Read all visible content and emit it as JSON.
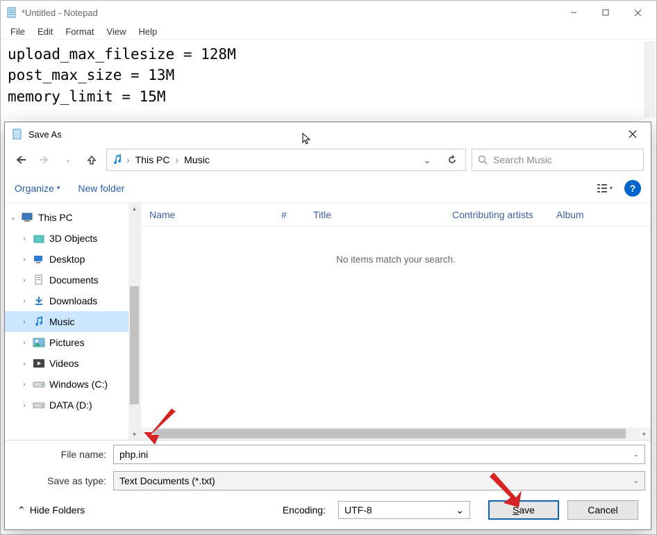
{
  "notepad": {
    "title": "*Untitled - Notepad",
    "menus": [
      "File",
      "Edit",
      "Format",
      "View",
      "Help"
    ],
    "content": "upload_max_filesize = 128M\npost_max_size = 13M\nmemory_limit = 15M"
  },
  "dialog": {
    "title": "Save As",
    "nav_back_enabled": true,
    "nav_forward_enabled": false,
    "breadcrumb": [
      "This PC",
      "Music"
    ],
    "search_placeholder": "Search Music",
    "organize_label": "Organize",
    "newfolder_label": "New folder",
    "tree": {
      "root": "This PC",
      "items": [
        {
          "label": "3D Objects",
          "icon": "folder-3d"
        },
        {
          "label": "Desktop",
          "icon": "desktop"
        },
        {
          "label": "Documents",
          "icon": "documents"
        },
        {
          "label": "Downloads",
          "icon": "downloads"
        },
        {
          "label": "Music",
          "icon": "music",
          "selected": true
        },
        {
          "label": "Pictures",
          "icon": "pictures"
        },
        {
          "label": "Videos",
          "icon": "videos"
        },
        {
          "label": "Windows (C:)",
          "icon": "drive"
        },
        {
          "label": "DATA (D:)",
          "icon": "drive"
        }
      ]
    },
    "columns": [
      "Name",
      "#",
      "Title",
      "Contributing artists",
      "Album"
    ],
    "empty_message": "No items match your search.",
    "filename_label": "File name:",
    "filename_value": "php.ini",
    "savetype_label": "Save as type:",
    "savetype_value": "Text Documents (*.txt)",
    "hide_folders_label": "Hide Folders",
    "encoding_label": "Encoding:",
    "encoding_value": "UTF-8",
    "save_label": "Save",
    "cancel_label": "Cancel"
  }
}
